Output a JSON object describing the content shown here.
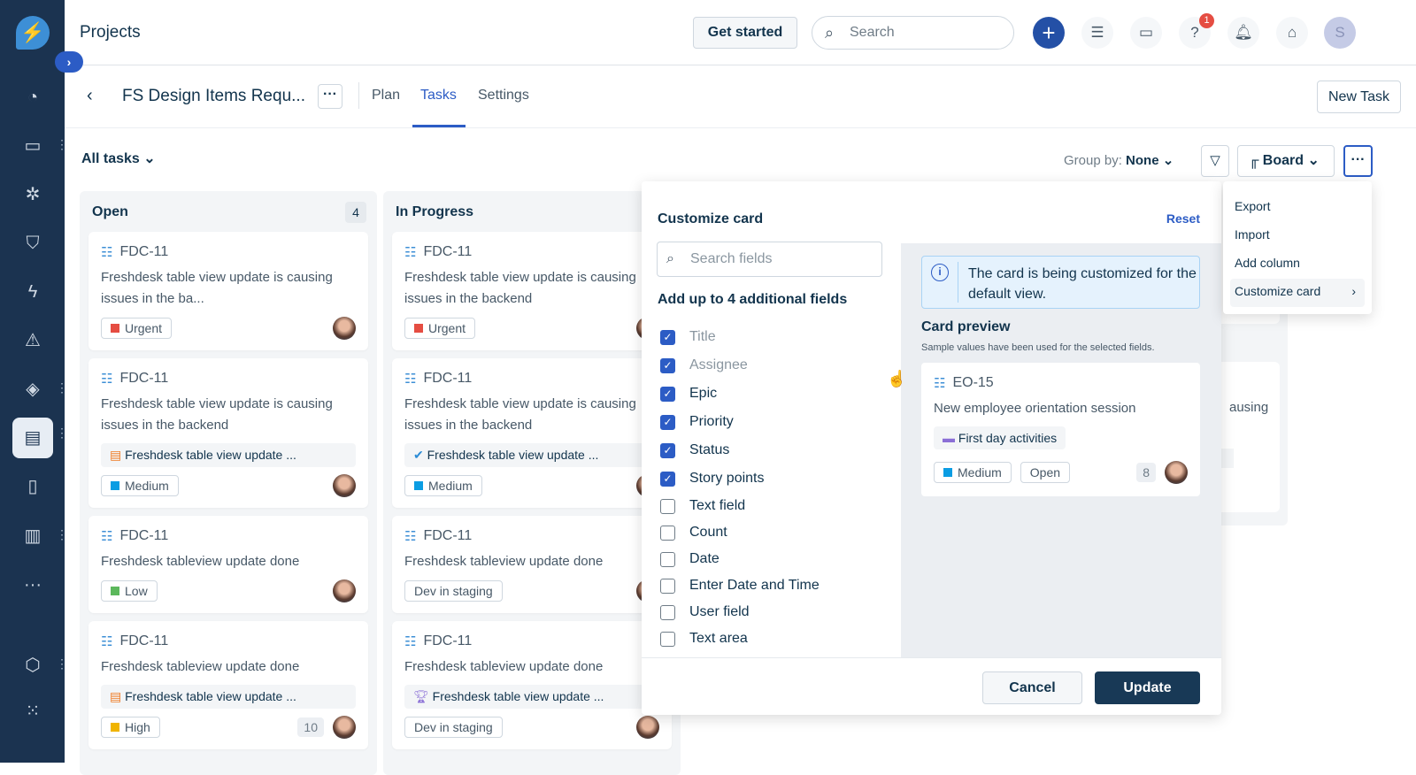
{
  "app": {
    "title": "Projects"
  },
  "colors": {
    "sidebar": "#1b3350",
    "accent": "#2c5cc5",
    "urgent": "#e54d42",
    "medium": "#0b9de3",
    "low": "#5cb85c",
    "high": "#f0b400",
    "primary_button": "#183956"
  },
  "sidebar": {
    "icons": [
      "dashboard-icon",
      "ticket-icon",
      "bug-icon",
      "shield-icon",
      "bolt-icon",
      "alert-icon",
      "layers-icon",
      "projects-icon",
      "book-icon",
      "analytics-icon",
      "more-icon",
      "cube-icon",
      "apps-icon"
    ]
  },
  "topbar": {
    "get_started": "Get started",
    "search_placeholder": "Search",
    "help_badge": "1",
    "avatar_initial": "S"
  },
  "project": {
    "name": "FS Design Items Requ...",
    "tabs": [
      "Plan",
      "Tasks",
      "Settings"
    ],
    "active_tab": "Tasks",
    "new_task": "New Task"
  },
  "toolbar": {
    "filter_label": "All tasks",
    "group_by_label": "Group by:",
    "group_by_value": "None",
    "view": "Board"
  },
  "columns": [
    {
      "name": "Open",
      "count": "4",
      "cards": [
        {
          "id": "FDC-11",
          "title": "Freshdesk table view update is causing issues in the ba...",
          "priority": "Urgent",
          "pcolor": "#e54d42"
        },
        {
          "id": "FDC-11",
          "title": "Freshdesk table view update is causing issues in the backend",
          "epic": "Freshdesk table view update ...",
          "epic_icon": "orange",
          "priority": "Medium",
          "pcolor": "#0b9de3"
        },
        {
          "id": "FDC-11",
          "title": "Freshdesk tableview update done",
          "priority": "Low",
          "pcolor": "#5cb85c"
        },
        {
          "id": "FDC-11",
          "title": "Freshdesk tableview update done",
          "epic": "Freshdesk table view update ...",
          "epic_icon": "orange",
          "priority": "High",
          "pcolor": "#f0b400",
          "points": "10"
        }
      ]
    },
    {
      "name": "In Progress",
      "cards": [
        {
          "id": "FDC-11",
          "title": "Freshdesk table view update is causing issues in the backend",
          "priority": "Urgent",
          "pcolor": "#e54d42"
        },
        {
          "id": "FDC-11",
          "title": "Freshdesk table view update is causing issues in the backend",
          "epic": "Freshdesk table view update ...",
          "epic_icon": "check",
          "priority": "Medium",
          "pcolor": "#0b9de3"
        },
        {
          "id": "FDC-11",
          "title": "Freshdesk tableview update done",
          "status": "Dev in staging"
        },
        {
          "id": "FDC-11",
          "title": "Freshdesk tableview update done",
          "epic": "Freshdesk table view update ...",
          "epic_icon": "trophy",
          "status": "Dev in staging"
        }
      ]
    }
  ],
  "hidden_column_snippet": "ausing",
  "customize": {
    "title": "Customize card",
    "reset": "Reset",
    "search_placeholder": "Search fields",
    "subtitle": "Add up to 4 additional fields",
    "fields": [
      {
        "label": "Title",
        "checked": true,
        "disabled": true
      },
      {
        "label": "Assignee",
        "checked": true,
        "disabled": true
      },
      {
        "label": "Epic",
        "checked": true
      },
      {
        "label": "Priority",
        "checked": true
      },
      {
        "label": "Status",
        "checked": true
      },
      {
        "label": "Story points",
        "checked": true
      },
      {
        "label": "Text field",
        "checked": false
      },
      {
        "label": "Count",
        "checked": false
      },
      {
        "label": "Date",
        "checked": false
      },
      {
        "label": "Enter Date and Time",
        "checked": false
      },
      {
        "label": "User field",
        "checked": false
      },
      {
        "label": "Text area",
        "checked": false
      }
    ],
    "info": "The card is being customized for the default view.",
    "preview_title": "Card preview",
    "preview_sub": "Sample values have been used for the selected fields.",
    "preview": {
      "id": "EO-15",
      "title": "New employee orientation session",
      "epic": "First day activities",
      "priority": "Medium",
      "status": "Open",
      "points": "8"
    },
    "cancel": "Cancel",
    "update": "Update"
  },
  "menu": {
    "items": [
      "Export",
      "Import",
      "Add column",
      "Customize card"
    ]
  }
}
